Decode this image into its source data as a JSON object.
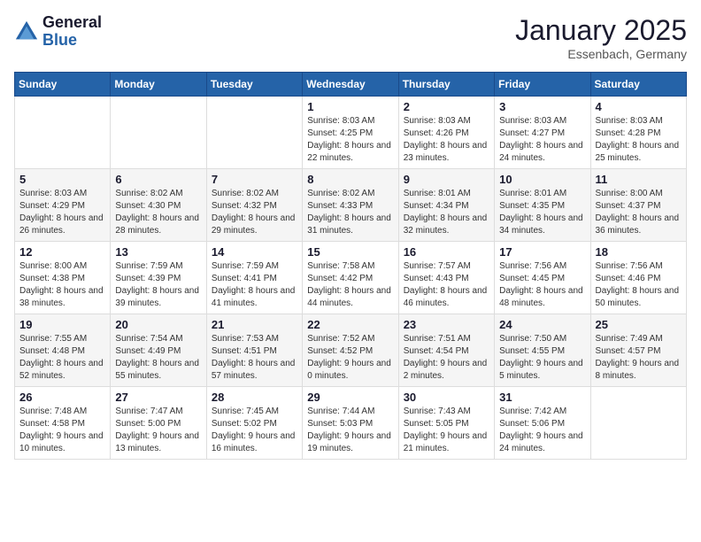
{
  "logo": {
    "general": "General",
    "blue": "Blue"
  },
  "title": "January 2025",
  "subtitle": "Essenbach, Germany",
  "days_header": [
    "Sunday",
    "Monday",
    "Tuesday",
    "Wednesday",
    "Thursday",
    "Friday",
    "Saturday"
  ],
  "weeks": [
    [
      {
        "day": "",
        "sunrise": "",
        "sunset": "",
        "daylight": ""
      },
      {
        "day": "",
        "sunrise": "",
        "sunset": "",
        "daylight": ""
      },
      {
        "day": "",
        "sunrise": "",
        "sunset": "",
        "daylight": ""
      },
      {
        "day": "1",
        "sunrise": "Sunrise: 8:03 AM",
        "sunset": "Sunset: 4:25 PM",
        "daylight": "Daylight: 8 hours and 22 minutes."
      },
      {
        "day": "2",
        "sunrise": "Sunrise: 8:03 AM",
        "sunset": "Sunset: 4:26 PM",
        "daylight": "Daylight: 8 hours and 23 minutes."
      },
      {
        "day": "3",
        "sunrise": "Sunrise: 8:03 AM",
        "sunset": "Sunset: 4:27 PM",
        "daylight": "Daylight: 8 hours and 24 minutes."
      },
      {
        "day": "4",
        "sunrise": "Sunrise: 8:03 AM",
        "sunset": "Sunset: 4:28 PM",
        "daylight": "Daylight: 8 hours and 25 minutes."
      }
    ],
    [
      {
        "day": "5",
        "sunrise": "Sunrise: 8:03 AM",
        "sunset": "Sunset: 4:29 PM",
        "daylight": "Daylight: 8 hours and 26 minutes."
      },
      {
        "day": "6",
        "sunrise": "Sunrise: 8:02 AM",
        "sunset": "Sunset: 4:30 PM",
        "daylight": "Daylight: 8 hours and 28 minutes."
      },
      {
        "day": "7",
        "sunrise": "Sunrise: 8:02 AM",
        "sunset": "Sunset: 4:32 PM",
        "daylight": "Daylight: 8 hours and 29 minutes."
      },
      {
        "day": "8",
        "sunrise": "Sunrise: 8:02 AM",
        "sunset": "Sunset: 4:33 PM",
        "daylight": "Daylight: 8 hours and 31 minutes."
      },
      {
        "day": "9",
        "sunrise": "Sunrise: 8:01 AM",
        "sunset": "Sunset: 4:34 PM",
        "daylight": "Daylight: 8 hours and 32 minutes."
      },
      {
        "day": "10",
        "sunrise": "Sunrise: 8:01 AM",
        "sunset": "Sunset: 4:35 PM",
        "daylight": "Daylight: 8 hours and 34 minutes."
      },
      {
        "day": "11",
        "sunrise": "Sunrise: 8:00 AM",
        "sunset": "Sunset: 4:37 PM",
        "daylight": "Daylight: 8 hours and 36 minutes."
      }
    ],
    [
      {
        "day": "12",
        "sunrise": "Sunrise: 8:00 AM",
        "sunset": "Sunset: 4:38 PM",
        "daylight": "Daylight: 8 hours and 38 minutes."
      },
      {
        "day": "13",
        "sunrise": "Sunrise: 7:59 AM",
        "sunset": "Sunset: 4:39 PM",
        "daylight": "Daylight: 8 hours and 39 minutes."
      },
      {
        "day": "14",
        "sunrise": "Sunrise: 7:59 AM",
        "sunset": "Sunset: 4:41 PM",
        "daylight": "Daylight: 8 hours and 41 minutes."
      },
      {
        "day": "15",
        "sunrise": "Sunrise: 7:58 AM",
        "sunset": "Sunset: 4:42 PM",
        "daylight": "Daylight: 8 hours and 44 minutes."
      },
      {
        "day": "16",
        "sunrise": "Sunrise: 7:57 AM",
        "sunset": "Sunset: 4:43 PM",
        "daylight": "Daylight: 8 hours and 46 minutes."
      },
      {
        "day": "17",
        "sunrise": "Sunrise: 7:56 AM",
        "sunset": "Sunset: 4:45 PM",
        "daylight": "Daylight: 8 hours and 48 minutes."
      },
      {
        "day": "18",
        "sunrise": "Sunrise: 7:56 AM",
        "sunset": "Sunset: 4:46 PM",
        "daylight": "Daylight: 8 hours and 50 minutes."
      }
    ],
    [
      {
        "day": "19",
        "sunrise": "Sunrise: 7:55 AM",
        "sunset": "Sunset: 4:48 PM",
        "daylight": "Daylight: 8 hours and 52 minutes."
      },
      {
        "day": "20",
        "sunrise": "Sunrise: 7:54 AM",
        "sunset": "Sunset: 4:49 PM",
        "daylight": "Daylight: 8 hours and 55 minutes."
      },
      {
        "day": "21",
        "sunrise": "Sunrise: 7:53 AM",
        "sunset": "Sunset: 4:51 PM",
        "daylight": "Daylight: 8 hours and 57 minutes."
      },
      {
        "day": "22",
        "sunrise": "Sunrise: 7:52 AM",
        "sunset": "Sunset: 4:52 PM",
        "daylight": "Daylight: 9 hours and 0 minutes."
      },
      {
        "day": "23",
        "sunrise": "Sunrise: 7:51 AM",
        "sunset": "Sunset: 4:54 PM",
        "daylight": "Daylight: 9 hours and 2 minutes."
      },
      {
        "day": "24",
        "sunrise": "Sunrise: 7:50 AM",
        "sunset": "Sunset: 4:55 PM",
        "daylight": "Daylight: 9 hours and 5 minutes."
      },
      {
        "day": "25",
        "sunrise": "Sunrise: 7:49 AM",
        "sunset": "Sunset: 4:57 PM",
        "daylight": "Daylight: 9 hours and 8 minutes."
      }
    ],
    [
      {
        "day": "26",
        "sunrise": "Sunrise: 7:48 AM",
        "sunset": "Sunset: 4:58 PM",
        "daylight": "Daylight: 9 hours and 10 minutes."
      },
      {
        "day": "27",
        "sunrise": "Sunrise: 7:47 AM",
        "sunset": "Sunset: 5:00 PM",
        "daylight": "Daylight: 9 hours and 13 minutes."
      },
      {
        "day": "28",
        "sunrise": "Sunrise: 7:45 AM",
        "sunset": "Sunset: 5:02 PM",
        "daylight": "Daylight: 9 hours and 16 minutes."
      },
      {
        "day": "29",
        "sunrise": "Sunrise: 7:44 AM",
        "sunset": "Sunset: 5:03 PM",
        "daylight": "Daylight: 9 hours and 19 minutes."
      },
      {
        "day": "30",
        "sunrise": "Sunrise: 7:43 AM",
        "sunset": "Sunset: 5:05 PM",
        "daylight": "Daylight: 9 hours and 21 minutes."
      },
      {
        "day": "31",
        "sunrise": "Sunrise: 7:42 AM",
        "sunset": "Sunset: 5:06 PM",
        "daylight": "Daylight: 9 hours and 24 minutes."
      },
      {
        "day": "",
        "sunrise": "",
        "sunset": "",
        "daylight": ""
      }
    ]
  ]
}
